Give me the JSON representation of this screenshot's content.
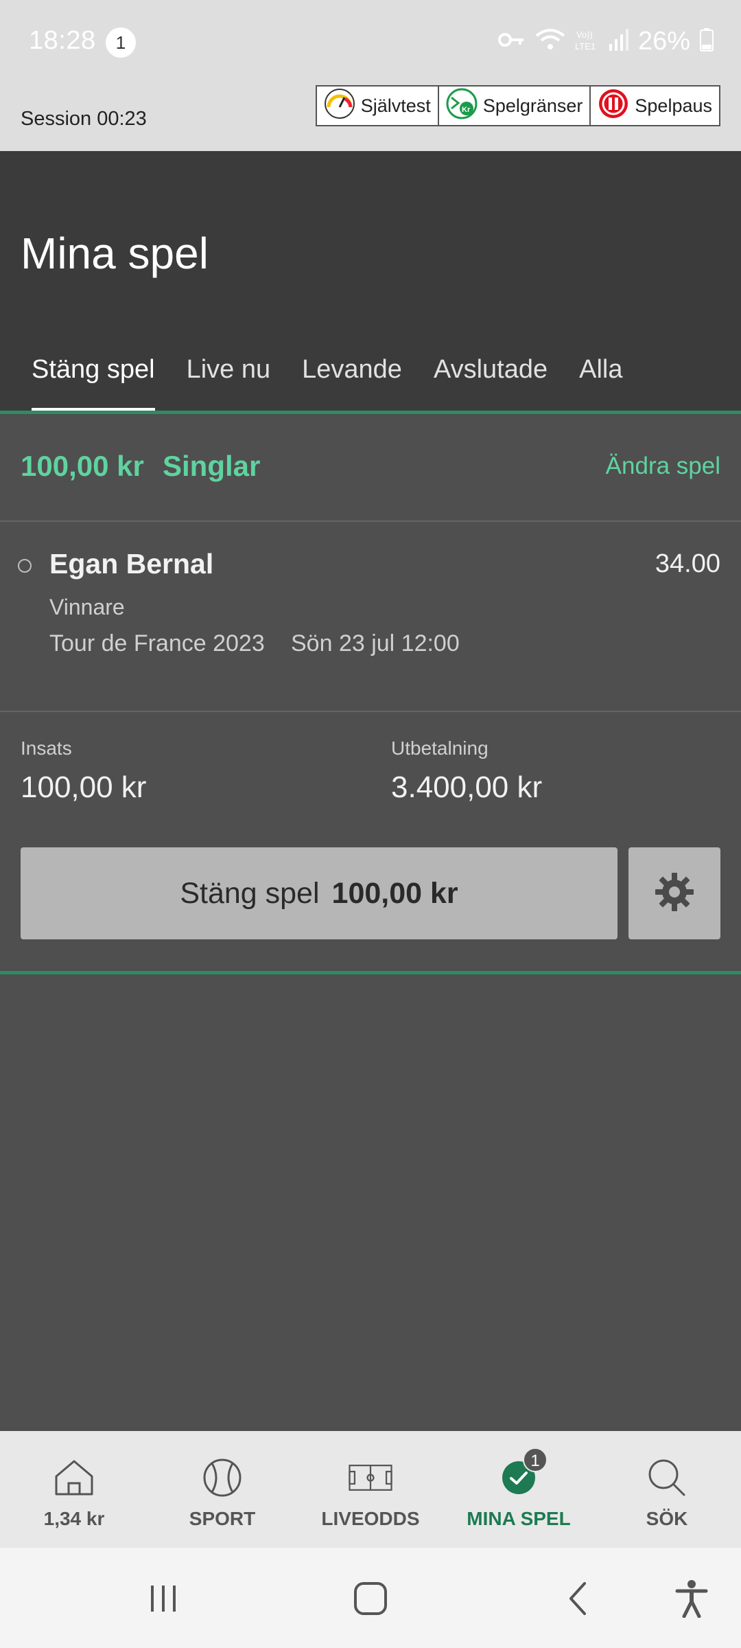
{
  "status_bar": {
    "time": "18:28",
    "notification_count": "1",
    "battery": "26%",
    "icons": [
      "vpn-key-icon",
      "wifi-icon",
      "volte-icon",
      "signal-icon",
      "battery-icon"
    ]
  },
  "session": {
    "label": "Session 00:23",
    "buttons": [
      {
        "label": "Självtest",
        "icon": "speedometer-icon"
      },
      {
        "label": "Spelgränser",
        "icon": "limit-kr-icon"
      },
      {
        "label": "Spelpaus",
        "icon": "pause-icon"
      }
    ]
  },
  "header": {
    "title": "Mina spel",
    "tabs": [
      "Stäng spel",
      "Live nu",
      "Levande",
      "Avslutade",
      "Alla"
    ],
    "active_tab": "Stäng spel"
  },
  "bet": {
    "amount": "100,00 kr",
    "type": "Singlar",
    "edit_label": "Ändra spel",
    "selection": {
      "name": "Egan Bernal",
      "odds": "34.00",
      "market": "Vinnare",
      "event": "Tour de France 2023",
      "date": "Sön 23 jul 12:00"
    },
    "stake_label": "Insats",
    "stake_value": "100,00 kr",
    "payout_label": "Utbetalning",
    "payout_value": "3.400,00 kr",
    "cashout_label": "Stäng spel",
    "cashout_amount": "100,00 kr"
  },
  "bottom_nav": {
    "items": [
      {
        "label": "1,34 kr",
        "icon": "home-icon"
      },
      {
        "label": "SPORT",
        "icon": "tennis-ball-icon"
      },
      {
        "label": "LIVEODDS",
        "icon": "football-pitch-icon"
      },
      {
        "label": "MINA SPEL",
        "icon": "checkmark-icon",
        "badge": "1"
      },
      {
        "label": "SÖK",
        "icon": "search-icon"
      }
    ],
    "active": "MINA SPEL"
  },
  "colors": {
    "accent_green": "#5fd3a0",
    "active_nav_green": "#1d7a52",
    "header_bg": "#3b3b3b",
    "content_bg": "#4f4f4f"
  }
}
